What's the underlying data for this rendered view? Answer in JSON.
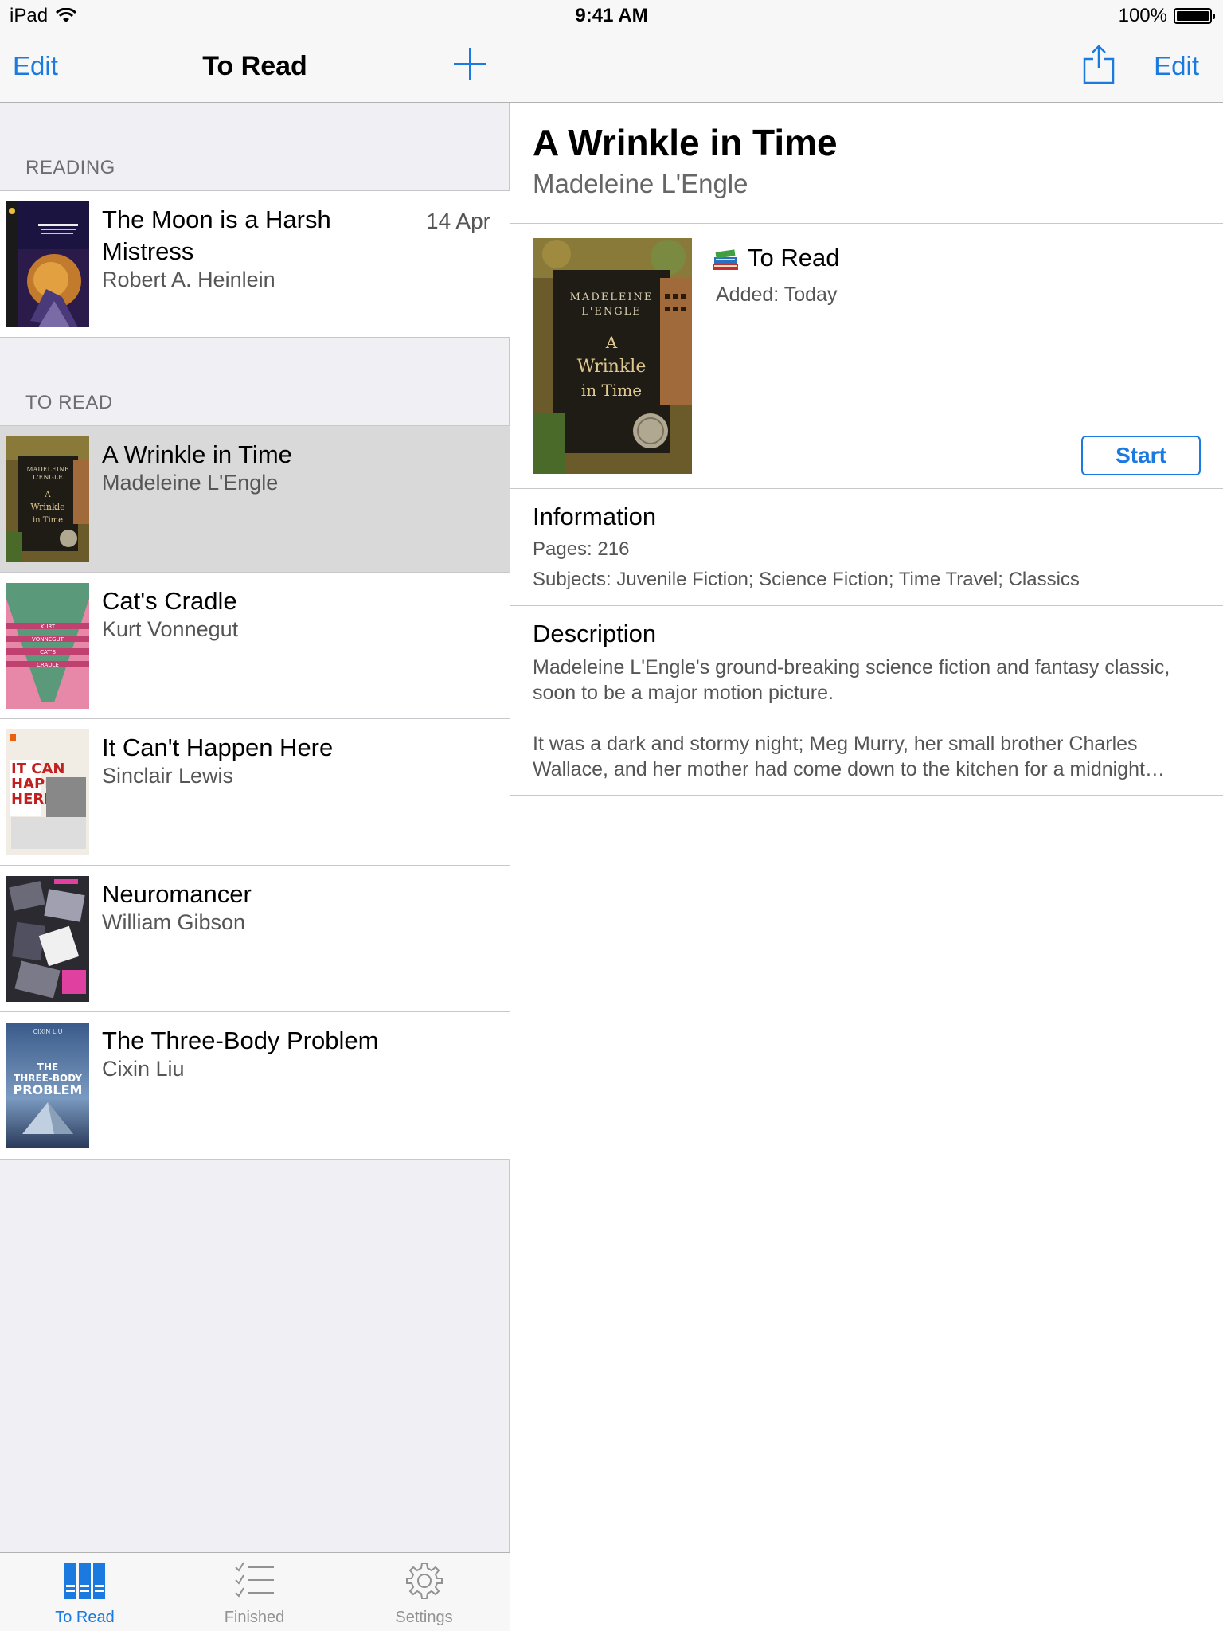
{
  "status_bar": {
    "device": "iPad",
    "time": "9:41 AM",
    "battery": "100%"
  },
  "master": {
    "nav": {
      "edit_label": "Edit",
      "title": "To Read"
    },
    "sections": [
      {
        "header": "READING",
        "books": [
          {
            "title": "The Moon is a Harsh Mistress",
            "author": "Robert A. Heinlein",
            "date": "14 Apr"
          }
        ]
      },
      {
        "header": "TO READ",
        "books": [
          {
            "title": "A Wrinkle in Time",
            "author": "Madeleine L'Engle"
          },
          {
            "title": "Cat's Cradle",
            "author": "Kurt Vonnegut"
          },
          {
            "title": "It Can't Happen Here",
            "author": "Sinclair Lewis"
          },
          {
            "title": "Neuromancer",
            "author": "William Gibson"
          },
          {
            "title": "The Three-Body Problem",
            "author": "Cixin Liu"
          }
        ]
      }
    ],
    "tabs": [
      {
        "label": "To Read",
        "icon": "books-icon"
      },
      {
        "label": "Finished",
        "icon": "checklist-icon"
      },
      {
        "label": "Settings",
        "icon": "gear-icon"
      }
    ]
  },
  "detail": {
    "nav": {
      "edit_label": "Edit"
    },
    "title": "A Wrinkle in Time",
    "author": "Madeleine L'Engle",
    "cover_text": {
      "author_line1": "MADELEINE",
      "author_line2": "L'ENGLE",
      "title_line1": "A",
      "title_line2": "Wrinkle",
      "title_line3": "in Time"
    },
    "status": "To Read",
    "added": "Added: Today",
    "start_label": "Start",
    "information": {
      "heading": "Information",
      "pages": "Pages: 216",
      "subjects": "Subjects: Juvenile Fiction; Science Fiction; Time Travel; Classics"
    },
    "description": {
      "heading": "Description",
      "para1": "Madeleine L'Engle's ground-breaking science fiction and fantasy classic, soon to be a major motion picture.",
      "para2": "It was a dark and stormy night; Meg Murry, her small brother Charles Wallace, and her mother had come down to the kitchen for a midnight…"
    }
  },
  "colors": {
    "accent": "#1a7ae0",
    "selected_row": "#d9d9d9",
    "grouped_bg": "#efeff4"
  }
}
